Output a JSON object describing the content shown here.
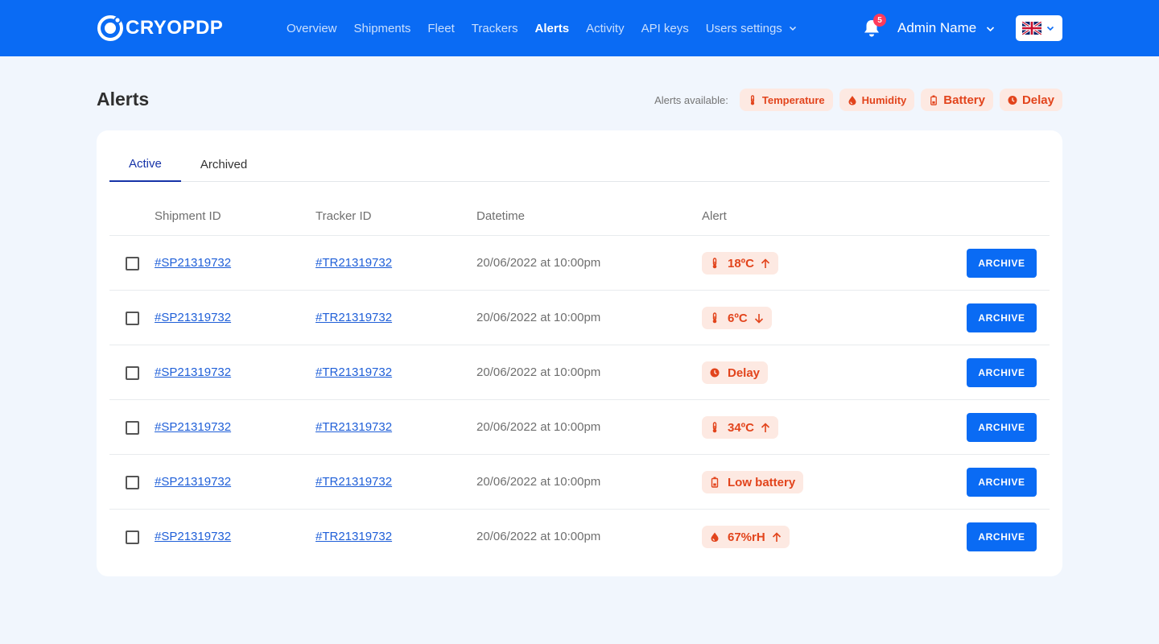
{
  "brand": {
    "name": "CRYOPDP"
  },
  "nav": {
    "items": [
      {
        "label": "Overview"
      },
      {
        "label": "Shipments"
      },
      {
        "label": "Fleet"
      },
      {
        "label": "Trackers"
      },
      {
        "label": "Alerts"
      },
      {
        "label": "Activity"
      },
      {
        "label": "API keys"
      },
      {
        "label": "Users settings"
      }
    ],
    "active": "Alerts"
  },
  "header": {
    "notification_count": "5",
    "user_name": "Admin Name",
    "language": "English (UK flag)"
  },
  "page": {
    "title": "Alerts",
    "alerts_available_label": "Alerts available:",
    "available_types": [
      {
        "label": "Temperature",
        "icon": "thermometer-icon"
      },
      {
        "label": "Humidity",
        "icon": "droplet-icon"
      },
      {
        "label": "Battery",
        "icon": "battery-icon"
      },
      {
        "label": "Delay",
        "icon": "clock-icon"
      }
    ]
  },
  "tabs": [
    {
      "label": "Active"
    },
    {
      "label": "Archived"
    }
  ],
  "table": {
    "columns": [
      "Shipment ID",
      "Tracker ID",
      "Datetime",
      "Alert"
    ],
    "archive_label": "ARCHIVE",
    "rows": [
      {
        "shipment_id": "#SP21319732",
        "tracker_id": "#TR21319732",
        "datetime": "20/06/2022 at 10:00pm",
        "alert": "18ºC",
        "alert_icon": "thermometer-icon",
        "trend": "up"
      },
      {
        "shipment_id": "#SP21319732",
        "tracker_id": "#TR21319732",
        "datetime": "20/06/2022 at 10:00pm",
        "alert": "6ºC",
        "alert_icon": "thermometer-icon",
        "trend": "down"
      },
      {
        "shipment_id": "#SP21319732",
        "tracker_id": "#TR21319732",
        "datetime": "20/06/2022 at 10:00pm",
        "alert": "Delay",
        "alert_icon": "clock-icon",
        "trend": "none"
      },
      {
        "shipment_id": "#SP21319732",
        "tracker_id": "#TR21319732",
        "datetime": "20/06/2022 at 10:00pm",
        "alert": "34ºC",
        "alert_icon": "thermometer-icon",
        "trend": "up"
      },
      {
        "shipment_id": "#SP21319732",
        "tracker_id": "#TR21319732",
        "datetime": "20/06/2022 at 10:00pm",
        "alert": "Low battery",
        "alert_icon": "battery-icon",
        "trend": "none"
      },
      {
        "shipment_id": "#SP21319732",
        "tracker_id": "#TR21319732",
        "datetime": "20/06/2022 at 10:00pm",
        "alert": "67%rH",
        "alert_icon": "droplet-icon",
        "trend": "up"
      }
    ]
  },
  "colors": {
    "primary": "#0a6bf4",
    "alert_text": "#e2441c",
    "alert_bg": "#fde9e2",
    "background": "#f1f6fd"
  }
}
